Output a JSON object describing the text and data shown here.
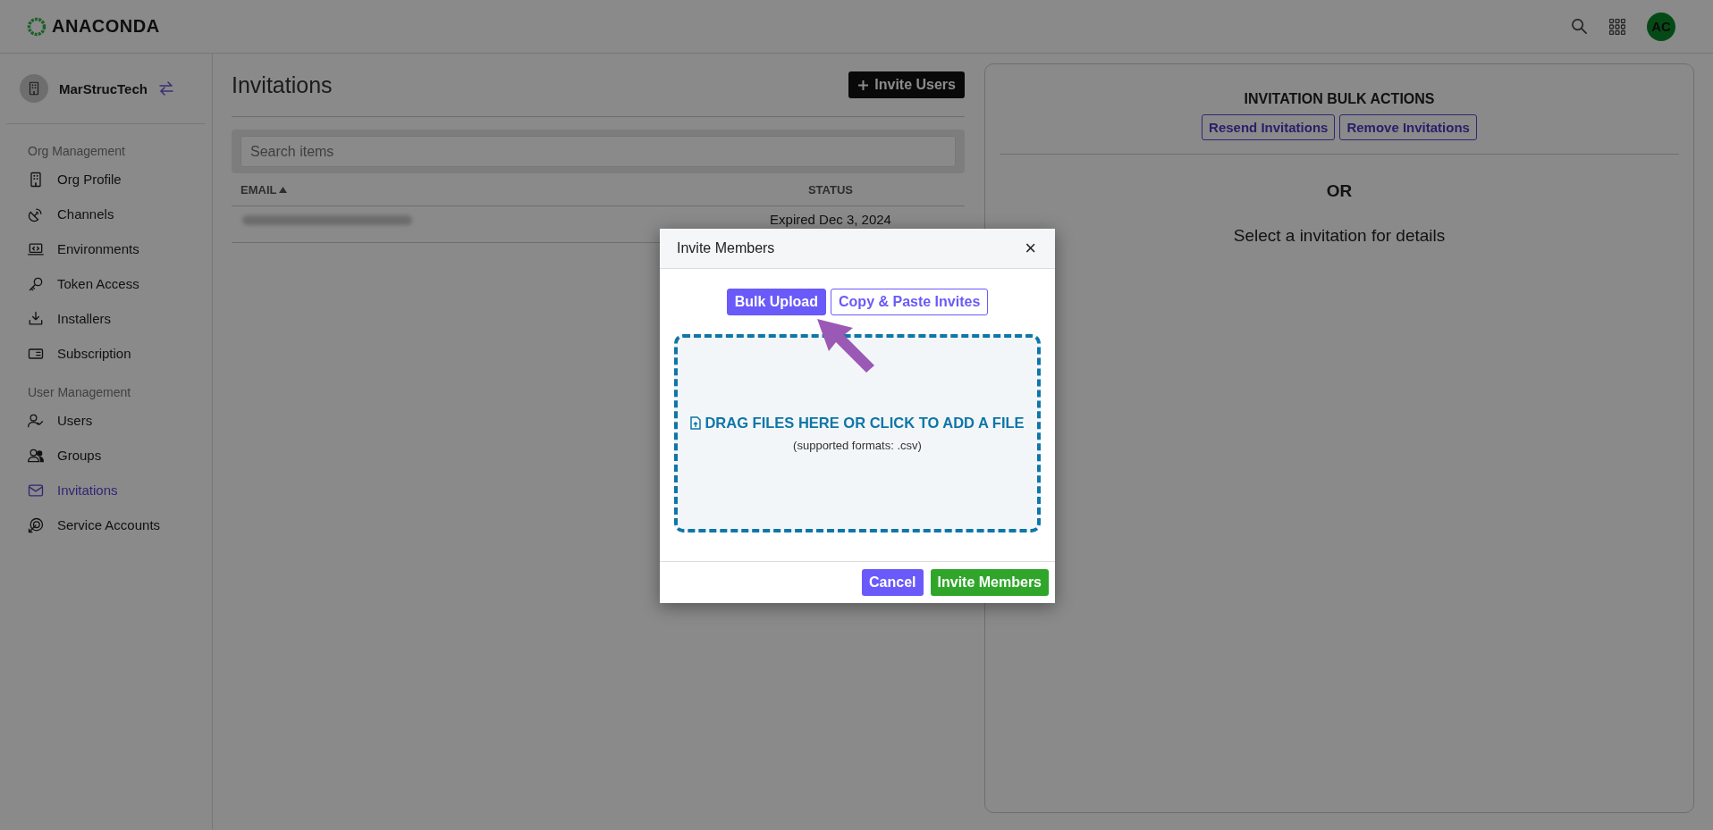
{
  "header": {
    "logo": "ANACONDA",
    "avatar": "AC"
  },
  "sidebar": {
    "org_name": "MarStrucTech",
    "sections": [
      {
        "title": "Org Management",
        "items": [
          {
            "label": "Org Profile",
            "selected": false
          },
          {
            "label": "Channels",
            "selected": false
          },
          {
            "label": "Environments",
            "selected": false
          },
          {
            "label": "Token Access",
            "selected": false
          },
          {
            "label": "Installers",
            "selected": false
          },
          {
            "label": "Subscription",
            "selected": false
          }
        ]
      },
      {
        "title": "User Management",
        "items": [
          {
            "label": "Users",
            "selected": false
          },
          {
            "label": "Groups",
            "selected": false
          },
          {
            "label": "Invitations",
            "selected": true
          },
          {
            "label": "Service Accounts",
            "selected": false
          }
        ]
      }
    ]
  },
  "main": {
    "title": "Invitations",
    "invite_button": "Invite Users",
    "search": {
      "placeholder": "Search items"
    },
    "table": {
      "columns": [
        {
          "label": "EMAIL",
          "sorted": true
        },
        {
          "label": "STATUS",
          "sorted": false
        }
      ],
      "rows": [
        {
          "status": "Expired Dec 3, 2024"
        }
      ]
    }
  },
  "details_panel": {
    "title": "INVITATION BULK ACTIONS",
    "buttons": [
      "Resend Invitations",
      "Remove Invitations"
    ],
    "or": "OR",
    "message": "Select a invitation for details"
  },
  "modal": {
    "title": "Invite Members",
    "close": "×",
    "tabs": [
      {
        "label": "Bulk Upload",
        "selected": true
      },
      {
        "label": "Copy & Paste Invites",
        "selected": false
      }
    ],
    "dropzone": {
      "prompt": "DRAG FILES HERE OR CLICK TO ADD A FILE",
      "hint": "(supported formats: .csv)"
    },
    "buttons": [
      {
        "label": "Cancel",
        "kind": "secondary"
      },
      {
        "label": "Invite Members",
        "kind": "primary"
      }
    ]
  }
}
